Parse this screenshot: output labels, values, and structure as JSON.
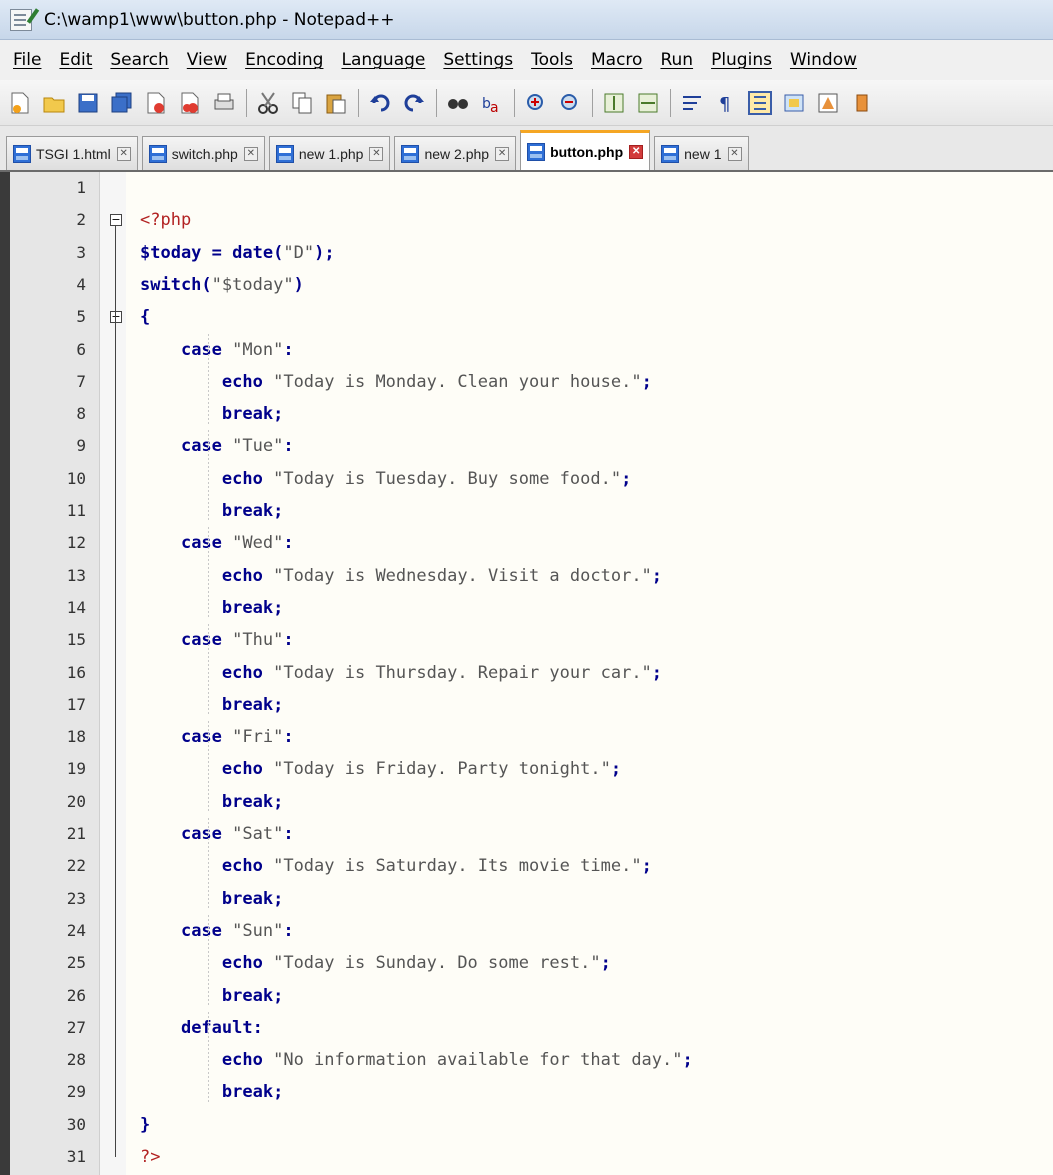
{
  "window": {
    "title": "C:\\wamp1\\www\\button.php - Notepad++"
  },
  "menu": [
    "File",
    "Edit",
    "Search",
    "View",
    "Encoding",
    "Language",
    "Settings",
    "Tools",
    "Macro",
    "Run",
    "Plugins",
    "Window"
  ],
  "toolbar": {
    "icons": [
      "new-file-icon",
      "open-file-icon",
      "save-icon",
      "save-all-icon",
      "close-icon",
      "close-all-icon",
      "print-icon",
      "cut-icon",
      "copy-icon",
      "paste-icon",
      "undo-icon",
      "redo-icon",
      "find-icon",
      "replace-icon",
      "zoom-in-icon",
      "zoom-out-icon",
      "sync-vertical-icon",
      "sync-horizontal-icon",
      "word-wrap-icon",
      "show-all-characters-icon",
      "indent-guide-icon",
      "user-defined-language-icon",
      "document-map-icon",
      "function-list-icon"
    ]
  },
  "tabs": [
    {
      "label": "TSGI 1.html",
      "active": false
    },
    {
      "label": "switch.php",
      "active": false
    },
    {
      "label": "new 1.php",
      "active": false
    },
    {
      "label": "new 2.php",
      "active": false
    },
    {
      "label": "button.php",
      "active": true
    },
    {
      "label": "new 1",
      "active": false
    }
  ],
  "editor": {
    "lines": [
      "",
      "<?php",
      "$today = date(\"D\");",
      "switch(\"$today\")",
      "{",
      "    case \"Mon\":",
      "        echo \"Today is Monday. Clean your house.\";",
      "        break;",
      "    case \"Tue\":",
      "        echo \"Today is Tuesday. Buy some food.\";",
      "        break;",
      "    case \"Wed\":",
      "        echo \"Today is Wednesday. Visit a doctor.\";",
      "        break;",
      "    case \"Thu\":",
      "        echo \"Today is Thursday. Repair your car.\";",
      "        break;",
      "    case \"Fri\":",
      "        echo \"Today is Friday. Party tonight.\";",
      "        break;",
      "    case \"Sat\":",
      "        echo \"Today is Saturday. Its movie time.\";",
      "        break;",
      "    case \"Sun\":",
      "        echo \"Today is Sunday. Do some rest.\";",
      "        break;",
      "    default:",
      "        echo \"No information available for that day.\";",
      "        break;",
      "}",
      "?>"
    ]
  }
}
